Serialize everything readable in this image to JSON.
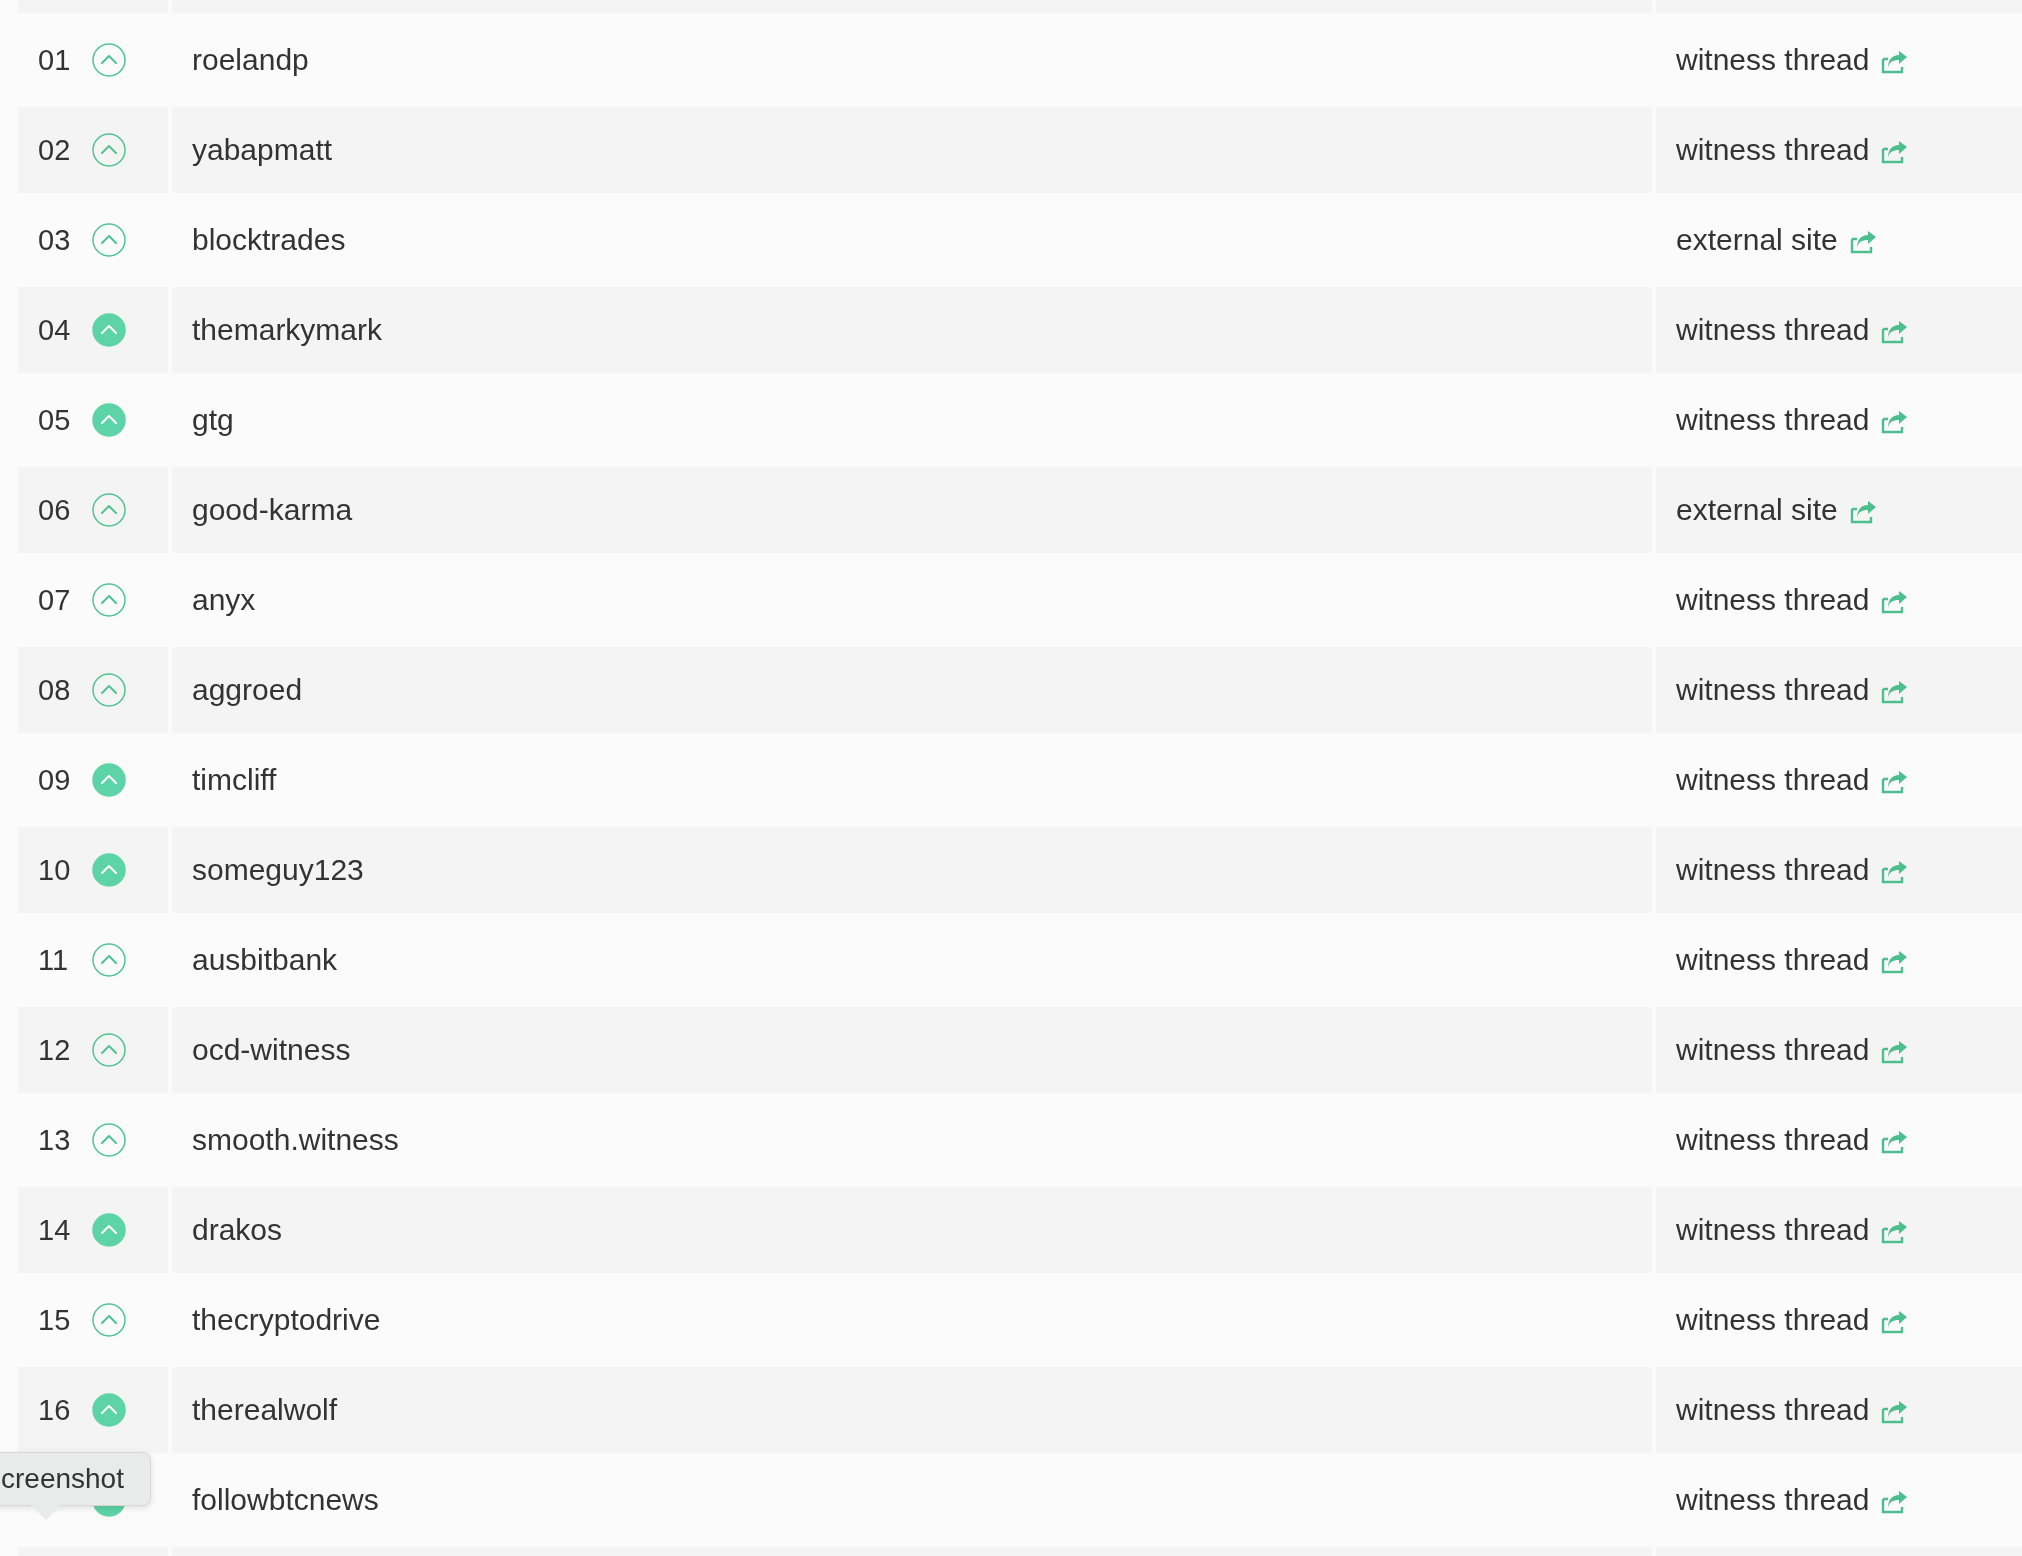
{
  "rows": [
    {
      "rank": "01",
      "account": "roelandp",
      "voted": false,
      "link": "witness thread"
    },
    {
      "rank": "02",
      "account": "yabapmatt",
      "voted": false,
      "link": "witness thread"
    },
    {
      "rank": "03",
      "account": "blocktrades",
      "voted": false,
      "link": "external site"
    },
    {
      "rank": "04",
      "account": "themarkymark",
      "voted": true,
      "link": "witness thread"
    },
    {
      "rank": "05",
      "account": "gtg",
      "voted": true,
      "link": "witness thread"
    },
    {
      "rank": "06",
      "account": "good-karma",
      "voted": false,
      "link": "external site"
    },
    {
      "rank": "07",
      "account": "anyx",
      "voted": false,
      "link": "witness thread"
    },
    {
      "rank": "08",
      "account": "aggroed",
      "voted": false,
      "link": "witness thread"
    },
    {
      "rank": "09",
      "account": "timcliff",
      "voted": true,
      "link": "witness thread"
    },
    {
      "rank": "10",
      "account": "someguy123",
      "voted": true,
      "link": "witness thread"
    },
    {
      "rank": "11",
      "account": "ausbitbank",
      "voted": false,
      "link": "witness thread"
    },
    {
      "rank": "12",
      "account": "ocd-witness",
      "voted": false,
      "link": "witness thread"
    },
    {
      "rank": "13",
      "account": "smooth.witness",
      "voted": false,
      "link": "witness thread"
    },
    {
      "rank": "14",
      "account": "drakos",
      "voted": true,
      "link": "witness thread"
    },
    {
      "rank": "15",
      "account": "thecryptodrive",
      "voted": false,
      "link": "witness thread"
    },
    {
      "rank": "16",
      "account": "therealwolf",
      "voted": true,
      "link": "witness thread"
    },
    {
      "account": "followbtcnews",
      "voted": true,
      "link": "witness thread"
    }
  ],
  "tooltip": {
    "text": "creenshot"
  }
}
